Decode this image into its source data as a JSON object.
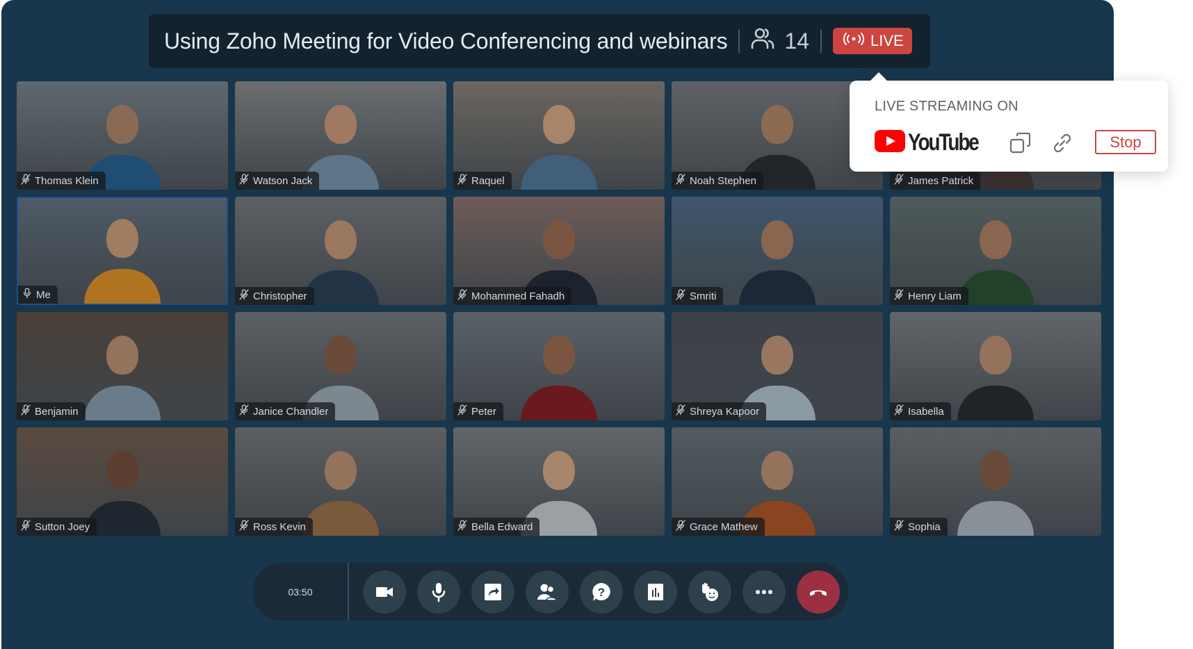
{
  "header": {
    "title": "Using Zoho Meeting for Video Conferencing and webinars",
    "participant_count": "14",
    "live_label": "LIVE",
    "icons": {
      "people": "people-icon",
      "live": "broadcast-icon"
    }
  },
  "participants": [
    {
      "name": "Thomas Klein",
      "muted": true,
      "skin": "#8a6a55",
      "shirt": "#1f4d73",
      "bg": "#606870"
    },
    {
      "name": "Watson Jack",
      "muted": true,
      "skin": "#a07a60",
      "shirt": "#5f7588",
      "bg": "#6a6e70"
    },
    {
      "name": "Raquel",
      "muted": true,
      "skin": "#a88468",
      "shirt": "#3f5f7a",
      "bg": "#6c6660"
    },
    {
      "name": "Noah Stephen",
      "muted": true,
      "skin": "#8c6a52",
      "shirt": "#22262a",
      "bg": "#5e6266"
    },
    {
      "name": "James Patrick",
      "muted": true,
      "skin": "#8a6650",
      "shirt": "#3a3030",
      "bg": "#54504c"
    },
    {
      "name": "Me",
      "muted": false,
      "self": true,
      "skin": "#a07c60",
      "shirt": "#b07420",
      "bg": "#4e5a66"
    },
    {
      "name": "Christopher",
      "muted": true,
      "skin": "#9a7860",
      "shirt": "#233447",
      "bg": "#5c6064"
    },
    {
      "name": "Mohammed Fahadh",
      "muted": true,
      "skin": "#7a5642",
      "shirt": "#1c232c",
      "bg": "#6e5c58"
    },
    {
      "name": "Smriti",
      "muted": true,
      "skin": "#8a6650",
      "shirt": "#1c2838",
      "bg": "#3e566c"
    },
    {
      "name": "Henry Liam",
      "muted": true,
      "skin": "#8a6650",
      "shirt": "#234028",
      "bg": "#4e5a5c"
    },
    {
      "name": "Benjamin",
      "muted": true,
      "skin": "#94725c",
      "shirt": "#6a7c8c",
      "bg": "#4a4038"
    },
    {
      "name": "Janice Chandler",
      "muted": true,
      "skin": "#6a4a38",
      "shirt": "#7c8890",
      "bg": "#5c6064"
    },
    {
      "name": "Peter",
      "muted": true,
      "skin": "#7a5640",
      "shirt": "#6a1a1e",
      "bg": "#5a6068"
    },
    {
      "name": "Shreya Kapoor",
      "muted": true,
      "skin": "#9a7660",
      "shirt": "#8c9aa4",
      "bg": "#3c4248"
    },
    {
      "name": "Isabella",
      "muted": true,
      "skin": "#94725c",
      "shirt": "#202428",
      "bg": "#62666a"
    },
    {
      "name": "Sutton Joey",
      "muted": true,
      "skin": "#5c3e30",
      "shirt": "#1e2630",
      "bg": "#5a4a3e"
    },
    {
      "name": "Ross Kevin",
      "muted": true,
      "skin": "#94725c",
      "shirt": "#7a5a3a",
      "bg": "#5c5e60"
    },
    {
      "name": "Bella Edward",
      "muted": true,
      "skin": "#a8866c",
      "shirt": "#9aa0a4",
      "bg": "#62666a"
    },
    {
      "name": "Grace Mathew",
      "muted": true,
      "skin": "#94725c",
      "shirt": "#8a4420",
      "bg": "#525a62"
    },
    {
      "name": "Sophia",
      "muted": true,
      "skin": "#6a4a38",
      "shirt": "#8a9098",
      "bg": "#5a5e62"
    }
  ],
  "popup": {
    "title": "LIVE STREAMING ON",
    "platform": "YouTube",
    "stop_label": "Stop",
    "icons": {
      "platform_logo": "youtube-icon",
      "copy": "copy-icon",
      "link": "link-icon"
    }
  },
  "toolbar": {
    "timer": "03:50",
    "buttons": [
      {
        "name": "video-camera",
        "label": "Camera"
      },
      {
        "name": "microphone",
        "label": "Microphone"
      },
      {
        "name": "share-screen",
        "label": "Share screen"
      },
      {
        "name": "participants",
        "label": "Participants"
      },
      {
        "name": "questions",
        "label": "Q&A"
      },
      {
        "name": "polls",
        "label": "Polls"
      },
      {
        "name": "raise-hand",
        "label": "Raise hand"
      },
      {
        "name": "more",
        "label": "More"
      },
      {
        "name": "end-call",
        "label": "Leave"
      }
    ]
  },
  "colors": {
    "window_bg": "#18364c",
    "live_red": "#cd4540",
    "end_call_red": "#9c2f40",
    "youtube_red": "#ff0000"
  }
}
